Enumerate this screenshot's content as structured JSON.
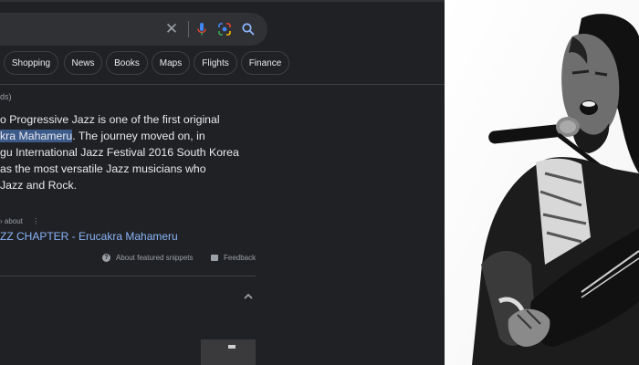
{
  "search": {
    "clear_icon": "close-icon",
    "mic_icon": "mic-icon",
    "lens_icon": "lens-icon",
    "search_icon": "search-icon"
  },
  "tabs": [
    "Shopping",
    "News",
    "Books",
    "Maps",
    "Flights",
    "Finance"
  ],
  "result": {
    "stats_fragment": "ds)",
    "snippet_lines": [
      {
        "before": "o Progressive Jazz is one of the first original",
        "highlight": "",
        "after": ""
      },
      {
        "before": "",
        "highlight": "kra Mahameru",
        "after": ". The journey moved on, in"
      },
      {
        "before": "gu International Jazz Festival 2016 South Korea",
        "highlight": "",
        "after": ""
      },
      {
        "before": "as the most versatile Jazz musicians who",
        "highlight": "",
        "after": ""
      },
      {
        "before": "Jazz and Rock.",
        "highlight": "",
        "after": ""
      }
    ],
    "source_fragment": "› about",
    "link_text": "ZZ CHAPTER - Erucakra Mahameru",
    "about_snippets": "About featured snippets",
    "feedback": "Feedback"
  },
  "colors": {
    "background": "#202124",
    "text": "#e8eaed",
    "link": "#8ab4f8",
    "highlight": "#3c5a8a",
    "muted": "#9aa0a6"
  }
}
